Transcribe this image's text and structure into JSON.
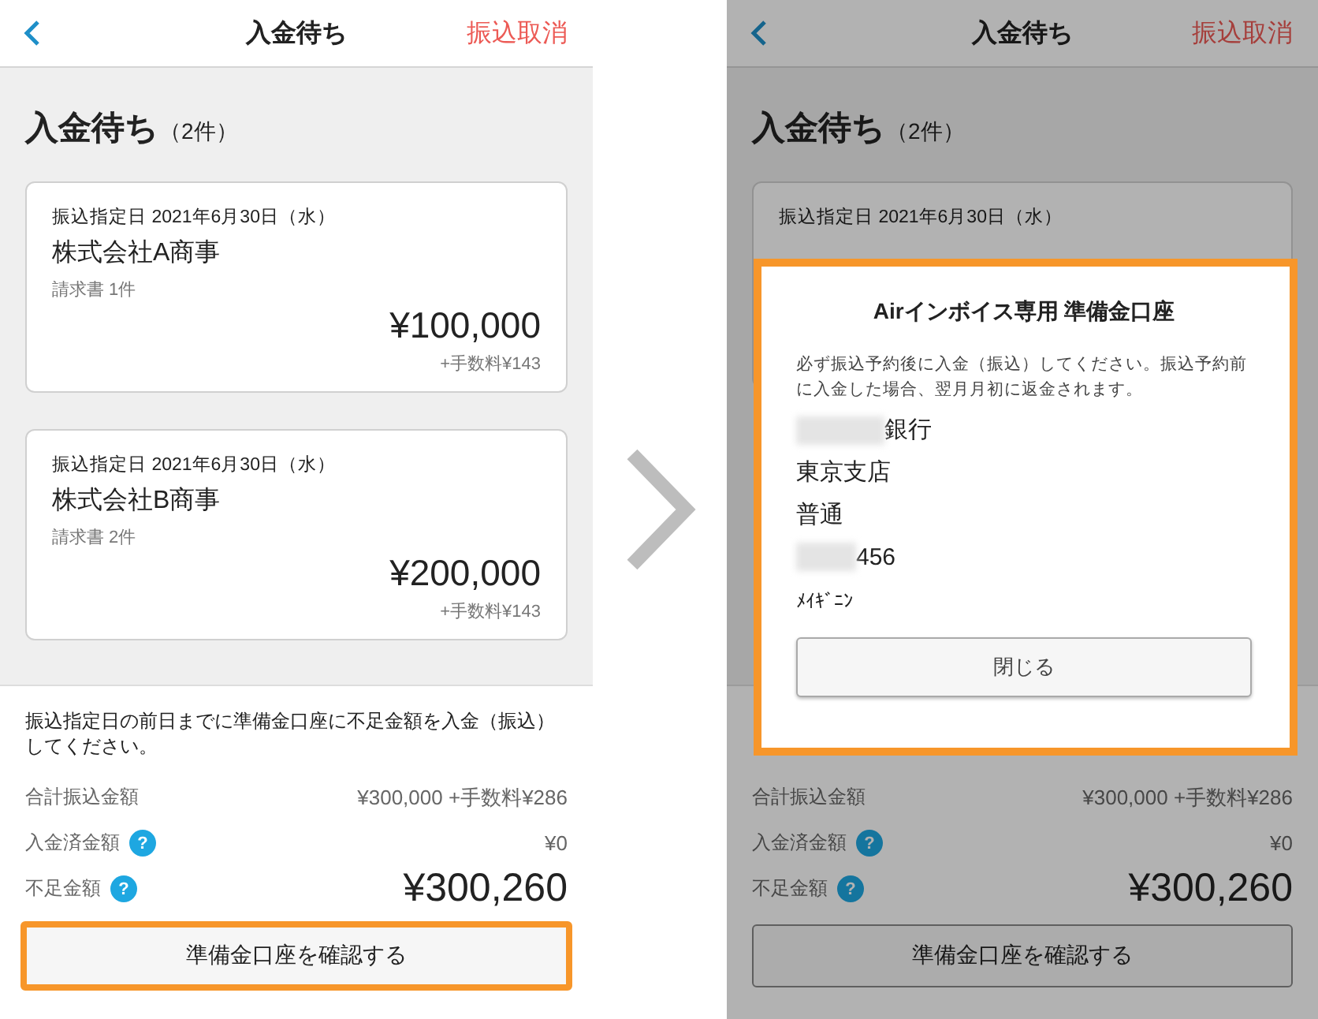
{
  "left_screen": {
    "header": {
      "title": "入金待ち",
      "action": "振込取消"
    },
    "section": {
      "title": "入金待ち",
      "count": "（2件）"
    },
    "cards": [
      {
        "date": "振込指定日 2021年6月30日（水）",
        "company": "株式会社A商事",
        "invoices": "請求書 1件",
        "amount": "¥100,000",
        "fee": "+手数料¥143"
      },
      {
        "date": "振込指定日 2021年6月30日（水）",
        "company": "株式会社B商事",
        "invoices": "請求書 2件",
        "amount": "¥200,000",
        "fee": "+手数料¥143"
      }
    ],
    "notice": "振込指定日の前日までに準備金口座に不足金額を入金（振込）してください。",
    "summary": [
      {
        "kind": "total",
        "label": "合計振込金額",
        "value": "¥300,000 +手数料¥286"
      },
      {
        "kind": "paid",
        "label": "入金済金額",
        "help": "?",
        "value": "¥0"
      },
      {
        "kind": "shortfall",
        "label": "不足金額",
        "help": "?",
        "value": "¥300,260"
      }
    ],
    "confirm_button": {
      "label": "準備金口座を確認する",
      "highlighted": true
    }
  },
  "right_screen": {
    "header": {
      "title": "入金待ち",
      "action": "振込取消"
    },
    "section": {
      "title": "入金待ち",
      "count": "（2件）"
    },
    "cards": [
      {
        "date": "振込指定日 2021年6月30日（水）"
      }
    ],
    "summary": [
      {
        "kind": "total",
        "label": "合計振込金額",
        "value": "¥300,000 +手数料¥286"
      },
      {
        "kind": "paid",
        "label": "入金済金額",
        "help": "?",
        "value": "¥0"
      },
      {
        "kind": "shortfall",
        "label": "不足金額",
        "help": "?",
        "value": "¥300,260"
      }
    ],
    "confirm_button": {
      "label": "準備金口座を確認する",
      "highlighted": false
    },
    "modal": {
      "title": "Airインボイス専用 準備金口座",
      "message": "必ず振込予約後に入金（振込）してください。振込予約前に入金した場合、翌月月初に返金されます。",
      "lines": [
        {
          "kind": "large",
          "text": "銀行",
          "redacted": true
        },
        {
          "kind": "large",
          "text": "東京支店",
          "redacted": false
        },
        {
          "kind": "large",
          "text": "普通",
          "redacted": false
        },
        {
          "kind": "large",
          "text": "456",
          "redacted": true
        },
        {
          "kind": "small",
          "text": "ﾒｲｷﾞﾆﾝ",
          "redacted": false
        }
      ],
      "close": "閉じる",
      "highlighted": true
    }
  }
}
